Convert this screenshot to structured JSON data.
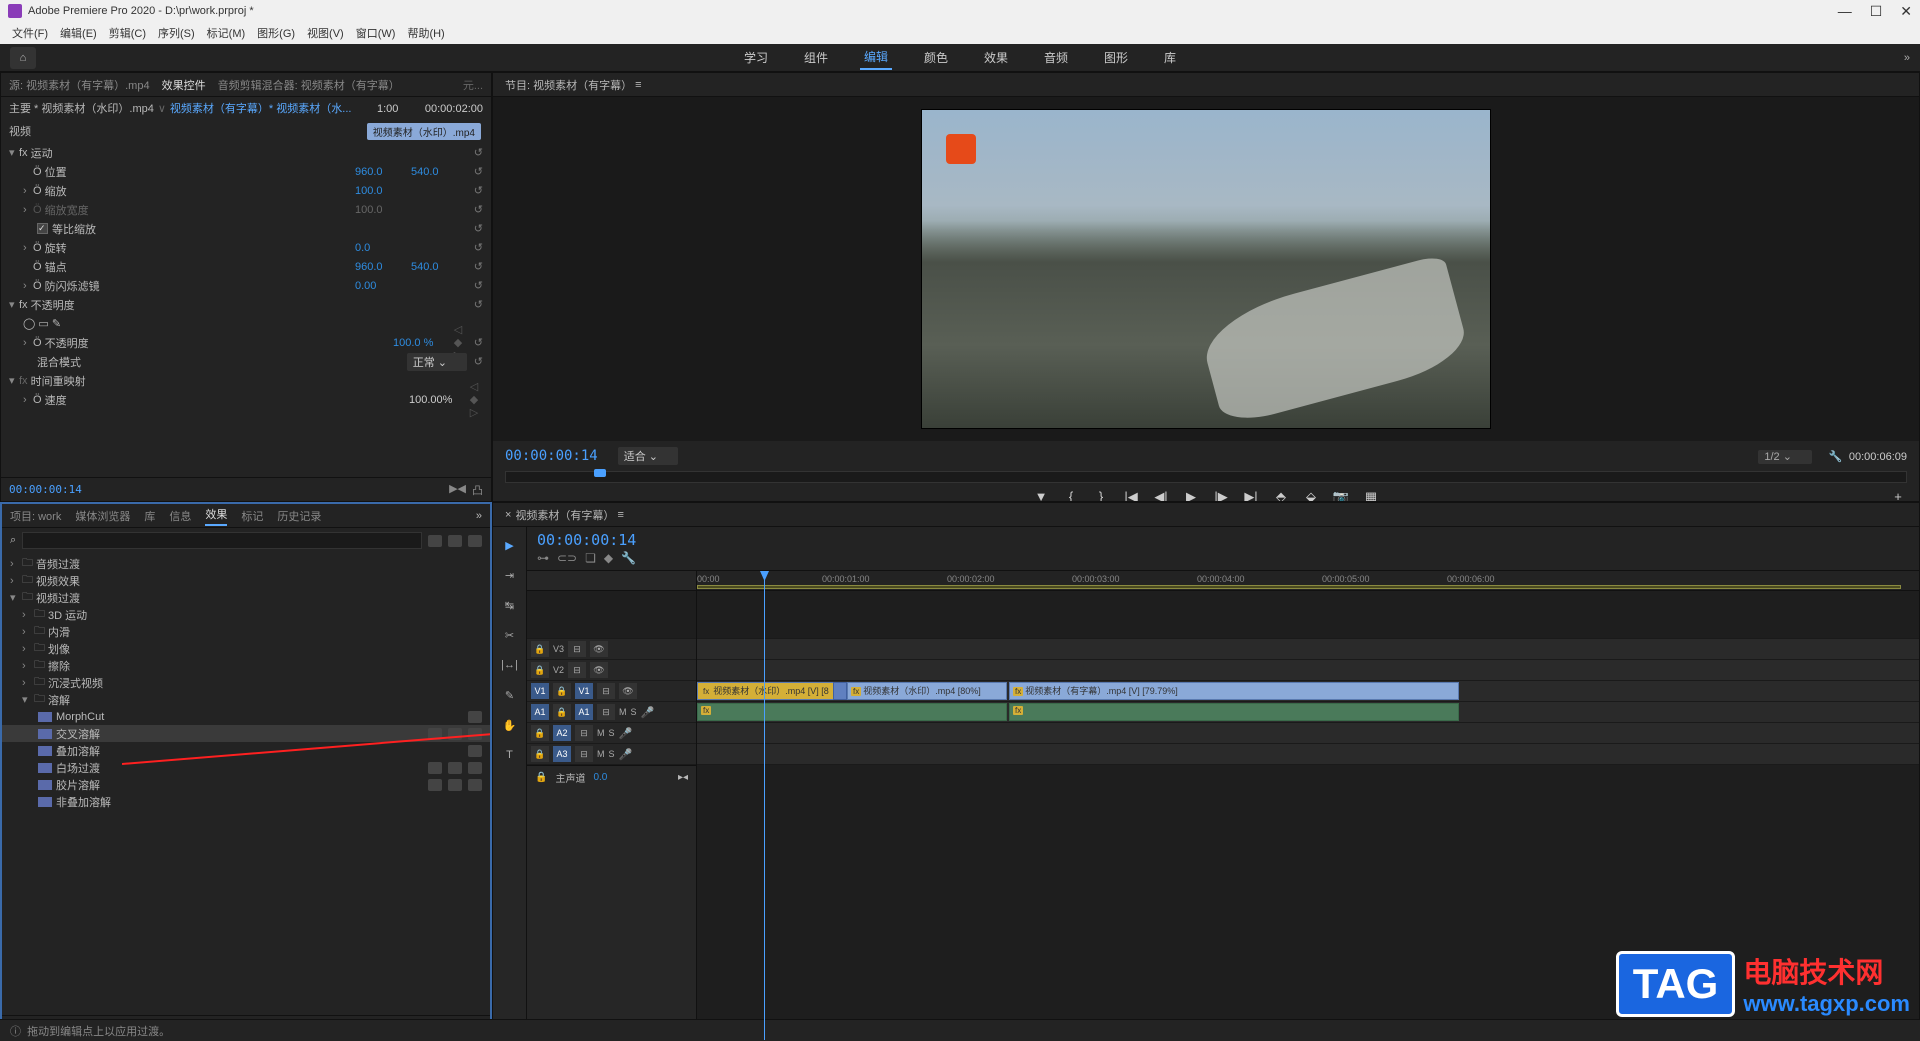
{
  "window": {
    "title": "Adobe Premiere Pro 2020 - D:\\pr\\work.prproj *"
  },
  "menus": [
    "文件(F)",
    "编辑(E)",
    "剪辑(C)",
    "序列(S)",
    "标记(M)",
    "图形(G)",
    "视图(V)",
    "窗口(W)",
    "帮助(H)"
  ],
  "topnav": {
    "items": [
      "学习",
      "组件",
      "编辑",
      "颜色",
      "效果",
      "音频",
      "图形",
      "库"
    ],
    "activeIndex": 2
  },
  "sourceTabs": {
    "items": [
      "源: 视频素材（有字幕）.mp4",
      "效果控件",
      "音频剪辑混合器: 视频素材（有字幕）",
      "元..."
    ],
    "activeIndex": 1
  },
  "effectControls": {
    "breadcrumb_main": "主要 * 视频素材（水印）.mp4",
    "breadcrumb_link": "视频素材（有字幕）* 视频素材（水...",
    "tc_start": "1:00",
    "tc_end": "00:00:02:00",
    "videoLabel": "视频",
    "clipName": "视频素材（水印）.mp4",
    "motion": {
      "label": "运动",
      "position": {
        "label": "位置",
        "x": "960.0",
        "y": "540.0"
      },
      "scale": {
        "label": "缩放",
        "value": "100.0"
      },
      "scaleWidth": {
        "label": "缩放宽度",
        "value": "100.0"
      },
      "uniform": {
        "label": "等比缩放",
        "checked": true
      },
      "rotation": {
        "label": "旋转",
        "value": "0.0"
      },
      "anchor": {
        "label": "锚点",
        "x": "960.0",
        "y": "540.0"
      },
      "antiflicker": {
        "label": "防闪烁滤镜",
        "value": "0.00"
      }
    },
    "opacity": {
      "label": "不透明度",
      "opacityProp": {
        "label": "不透明度",
        "value": "100.0 %"
      },
      "blend": {
        "label": "混合模式",
        "value": "正常"
      }
    },
    "timeRemap": {
      "label": "时间重映射",
      "speed": {
        "label": "速度",
        "value": "100.00%"
      }
    },
    "footerTC": "00:00:00:14"
  },
  "program": {
    "header": "节目: 视频素材（有字幕）",
    "tc": "00:00:00:14",
    "fit": "适合",
    "resolution": "1/2",
    "duration": "00:00:06:09"
  },
  "projectTabs": {
    "items": [
      "项目: work",
      "媒体浏览器",
      "库",
      "信息",
      "效果",
      "标记",
      "历史记录"
    ],
    "activeIndex": 4
  },
  "effectsTree": {
    "audioTransitions": "音频过渡",
    "videoEffects": "视频效果",
    "videoTransitions": "视频过渡",
    "sub": {
      "motion3d": "3D 运动",
      "slide": "内滑",
      "wipe": "划像",
      "push": "擦除",
      "immersive": "沉浸式视频",
      "dissolve": "溶解",
      "items": {
        "morphcut": "MorphCut",
        "crossdissolve": "交叉溶解",
        "additive": "叠加溶解",
        "dipwhite": "白场过渡",
        "film": "胶片溶解",
        "nonadditive": "非叠加溶解"
      }
    }
  },
  "timeline": {
    "header": "视频素材（有字幕）",
    "tc": "00:00:00:14",
    "ruler": [
      "00:00",
      "00:00:01:00",
      "00:00:02:00",
      "00:00:03:00",
      "00:00:04:00",
      "00:00:05:00",
      "00:00:06:00"
    ],
    "tracks": {
      "v3": "V3",
      "v2": "V2",
      "v1": "V1",
      "a1": "A1",
      "a2": "A2",
      "a3": "A3"
    },
    "clips": {
      "v1a": "视频素材（水印）.mp4 [V] [8",
      "v1b": "视频素材（水印）.mp4 [80%]",
      "v1c": "视频素材（有字幕）.mp4 [V] [79.79%]"
    },
    "master": {
      "label": "主声道",
      "value": "0.0"
    }
  },
  "statusBar": "拖动到编辑点上以应用过渡。",
  "watermark": {
    "tag": "TAG",
    "cn": "电脑技术网",
    "url": "www.tagxp.com"
  }
}
